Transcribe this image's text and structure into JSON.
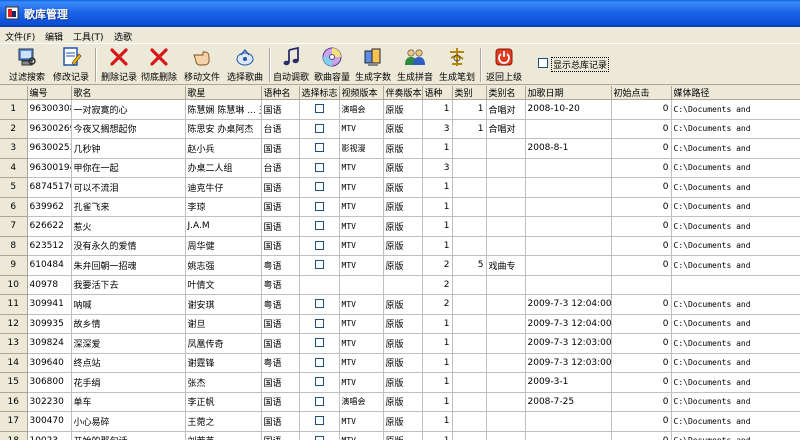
{
  "window": {
    "title": "歌库管理"
  },
  "menu": [
    "文件(F)",
    "编辑",
    "工具(T)",
    "选歌"
  ],
  "toolbar": {
    "buttons": [
      {
        "label": "过滤搜索",
        "icon": "filter-search-icon"
      },
      {
        "label": "修改记录",
        "icon": "edit-record-icon"
      },
      {
        "label": "删除记录",
        "icon": "delete-icon"
      },
      {
        "label": "彻底删除",
        "icon": "delete-icon"
      },
      {
        "label": "移动文件",
        "icon": "hand-pointer-icon"
      },
      {
        "label": "选择歌曲",
        "icon": "pick-song-icon"
      },
      {
        "label": "自动调歌",
        "icon": "music-note-icon"
      },
      {
        "label": "歌曲容量",
        "icon": "disc-icon"
      },
      {
        "label": "生成字数",
        "icon": "generate-count-icon"
      },
      {
        "label": "生成拼音",
        "icon": "users-icon"
      },
      {
        "label": "生成笔划",
        "icon": "stroke-icon"
      },
      {
        "label": "返回上级",
        "icon": "power-icon"
      }
    ],
    "show_total_label": "显示总库记录"
  },
  "table": {
    "columns": [
      "编号",
      "歌名",
      "歌星",
      "语种名",
      "选择标志",
      "视频版本",
      "伴奏版本",
      "语种",
      "类别",
      "类别名",
      "加歌日期",
      "初始点击",
      "媒体路径"
    ],
    "rows": [
      {
        "n": "1",
        "id": "96300308",
        "name": "一对寂寞的心",
        "singer": "陈慧娴 陈慧琳 ... 王杰",
        "lang": "国语",
        "video": "演唱会",
        "accomp": "原版",
        "yz": "1",
        "cat": "1",
        "catname": "合唱对",
        "date": "2008-10-20",
        "clicks": "0",
        "path": "C:\\Documents and"
      },
      {
        "n": "2",
        "id": "96300269",
        "name": "今夜又搁想起你",
        "singer": "陈思安 办桌阿杰",
        "lang": "台语",
        "video": "MTV",
        "accomp": "原版",
        "yz": "3",
        "cat": "1",
        "catname": "合唱对",
        "date": "",
        "clicks": "0",
        "path": "C:\\Documents and"
      },
      {
        "n": "3",
        "id": "96300253",
        "name": "几秒钟",
        "singer": "赵小兵",
        "lang": "国语",
        "video": "影视漫",
        "accomp": "原版",
        "yz": "1",
        "cat": "",
        "catname": "",
        "date": "2008-8-1",
        "clicks": "0",
        "path": "C:\\Documents and"
      },
      {
        "n": "4",
        "id": "96300194",
        "name": "甲你在一起",
        "singer": "办桌二人组",
        "lang": "台语",
        "video": "MTV",
        "accomp": "原版",
        "yz": "3",
        "cat": "",
        "catname": "",
        "date": "",
        "clicks": "0",
        "path": "C:\\Documents and"
      },
      {
        "n": "5",
        "id": "68745170",
        "name": "可以不流泪",
        "singer": "迪克牛仔",
        "lang": "国语",
        "video": "MTV",
        "accomp": "原版",
        "yz": "1",
        "cat": "",
        "catname": "",
        "date": "",
        "clicks": "0",
        "path": "C:\\Documents and"
      },
      {
        "n": "6",
        "id": "639962",
        "name": "孔雀飞来",
        "singer": "李琼",
        "lang": "国语",
        "video": "MTV",
        "accomp": "原版",
        "yz": "1",
        "cat": "",
        "catname": "",
        "date": "",
        "clicks": "0",
        "path": "C:\\Documents and"
      },
      {
        "n": "7",
        "id": "626622",
        "name": "惹火",
        "singer": "J.A.M",
        "lang": "国语",
        "video": "MTV",
        "accomp": "原版",
        "yz": "1",
        "cat": "",
        "catname": "",
        "date": "",
        "clicks": "0",
        "path": "C:\\Documents and"
      },
      {
        "n": "8",
        "id": "623512",
        "name": "没有永久的爱情",
        "singer": "周华健",
        "lang": "国语",
        "video": "MTV",
        "accomp": "原版",
        "yz": "1",
        "cat": "",
        "catname": "",
        "date": "",
        "clicks": "0",
        "path": "C:\\Documents and"
      },
      {
        "n": "9",
        "id": "610484",
        "name": "朱弁回朝一招魂",
        "singer": "姚志强",
        "lang": "粤语",
        "video": "MTV",
        "accomp": "原版",
        "yz": "2",
        "cat": "5",
        "catname": "戏曲专",
        "date": "",
        "clicks": "0",
        "path": "C:\\Documents and"
      },
      {
        "n": "10",
        "id": "40978",
        "name": "我要活下去",
        "singer": "叶倩文",
        "lang": "粤语",
        "video": "",
        "accomp": "",
        "yz": "2",
        "cat": "",
        "catname": "",
        "date": "",
        "clicks": "",
        "path": ""
      },
      {
        "n": "11",
        "id": "309941",
        "name": "呐喊",
        "singer": "谢安琪",
        "lang": "粤语",
        "video": "MTV",
        "accomp": "原版",
        "yz": "2",
        "cat": "",
        "catname": "",
        "date": "2009-7-3 12:04:00",
        "clicks": "0",
        "path": "C:\\Documents and"
      },
      {
        "n": "12",
        "id": "309935",
        "name": "故乡情",
        "singer": "谢旦",
        "lang": "国语",
        "video": "MTV",
        "accomp": "原版",
        "yz": "1",
        "cat": "",
        "catname": "",
        "date": "2009-7-3 12:04:00",
        "clicks": "0",
        "path": "C:\\Documents and"
      },
      {
        "n": "13",
        "id": "309824",
        "name": "深深爱",
        "singer": "凤凰传奇",
        "lang": "国语",
        "video": "MTV",
        "accomp": "原版",
        "yz": "1",
        "cat": "",
        "catname": "",
        "date": "2009-7-3 12:03:00",
        "clicks": "0",
        "path": "C:\\Documents and"
      },
      {
        "n": "14",
        "id": "309640",
        "name": "终点站",
        "singer": "谢霆锋",
        "lang": "粤语",
        "video": "MTV",
        "accomp": "原版",
        "yz": "1",
        "cat": "",
        "catname": "",
        "date": "2009-7-3 12:03:00",
        "clicks": "0",
        "path": "C:\\Documents and"
      },
      {
        "n": "15",
        "id": "306800",
        "name": "花手绢",
        "singer": "张杰",
        "lang": "国语",
        "video": "MTV",
        "accomp": "原版",
        "yz": "1",
        "cat": "",
        "catname": "",
        "date": "2009-3-1",
        "clicks": "0",
        "path": "C:\\Documents and"
      },
      {
        "n": "16",
        "id": "302230",
        "name": "单车",
        "singer": "李正帆",
        "lang": "国语",
        "video": "演唱会",
        "accomp": "原版",
        "yz": "1",
        "cat": "",
        "catname": "",
        "date": "2008-7-25",
        "clicks": "0",
        "path": "C:\\Documents and"
      },
      {
        "n": "17",
        "id": "300470",
        "name": "小心易碎",
        "singer": "王菀之",
        "lang": "国语",
        "video": "MTV",
        "accomp": "原版",
        "yz": "1",
        "cat": "",
        "catname": "",
        "date": "",
        "clicks": "0",
        "path": "C:\\Documents and"
      },
      {
        "n": "18",
        "id": "10023",
        "name": "开始的那句话",
        "singer": "刘若英",
        "lang": "国语",
        "video": "MTV",
        "accomp": "原版",
        "yz": "1",
        "cat": "",
        "catname": "",
        "date": "",
        "clicks": "0",
        "path": "C:\\Documents and"
      }
    ]
  }
}
